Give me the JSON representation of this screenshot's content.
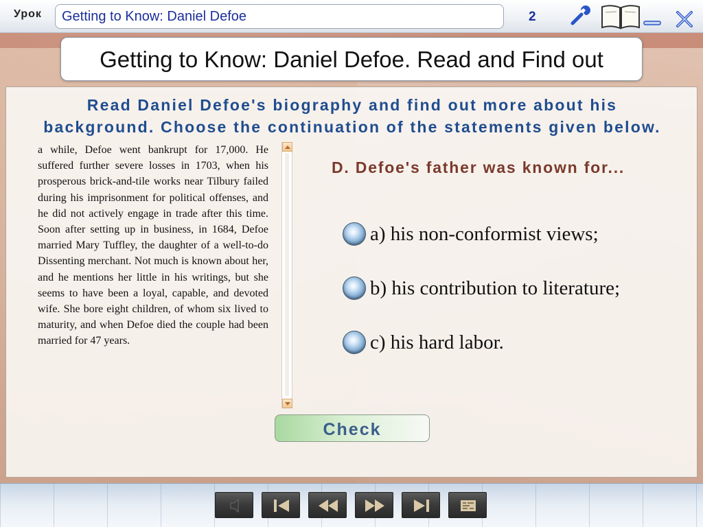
{
  "topbar": {
    "lesson_label": "Урок",
    "lesson_title": "Getting to Know: Daniel Defoe",
    "page_number": "2"
  },
  "header": {
    "title": "Getting to Know: Daniel Defoe. Read and Find out"
  },
  "instructions": {
    "line1": "Read Daniel Defoe's biography and find out more about his",
    "line2": "background. Choose the continuation of the statements given below."
  },
  "biography": {
    "text": "a while, Defoe went bankrupt for 17,000. He suffered further severe losses in 1703, when his prosperous brick-and-tile works near Tilbury failed during his imprisonment for political offenses, and he did not actively engage in trade after this time. Soon after setting up in business, in 1684, Defoe married Mary Tuffley, the daughter of a well-to-do Dissenting merchant. Not much is known about her, and he mentions her little in his writings, but she seems to have been a loyal, capable, and devoted wife. She bore eight children, of whom six lived to maturity, and when Defoe died the couple had been married for 47 years."
  },
  "question": {
    "text": "D. Defoe's father was known for...",
    "options": [
      "a) his non-conformist views;",
      "b) his contribution to literature;",
      "c) his hard labor."
    ]
  },
  "check_label": "Check",
  "icons": {
    "settings": "wrench-icon",
    "book": "book-icon",
    "minimize": "minimize-icon",
    "close": "close-icon",
    "nav": [
      "sound-icon",
      "first-page-icon",
      "previous-icon",
      "next-icon",
      "last-page-icon",
      "map-icon"
    ]
  },
  "colors": {
    "title_blue": "#1b2f9a",
    "instruction_blue": "#1f4d8f",
    "question_brown": "#7a3a2c"
  }
}
